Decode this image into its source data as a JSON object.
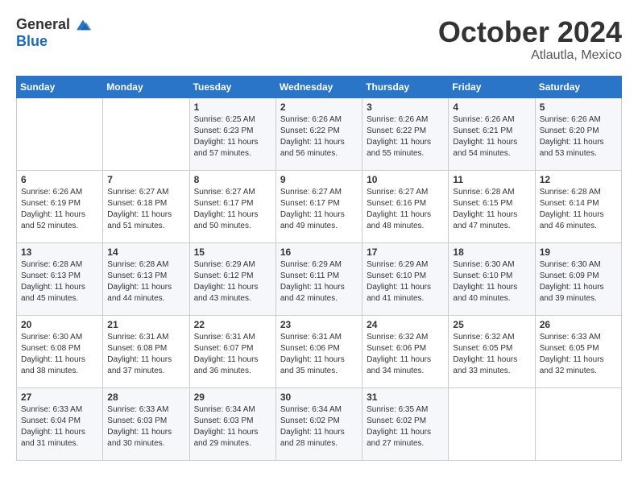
{
  "logo": {
    "general": "General",
    "blue": "Blue"
  },
  "title": "October 2024",
  "subtitle": "Atlautla, Mexico",
  "days_of_week": [
    "Sunday",
    "Monday",
    "Tuesday",
    "Wednesday",
    "Thursday",
    "Friday",
    "Saturday"
  ],
  "weeks": [
    [
      {
        "day": "",
        "info": ""
      },
      {
        "day": "",
        "info": ""
      },
      {
        "day": "1",
        "info": "Sunrise: 6:25 AM\nSunset: 6:23 PM\nDaylight: 11 hours and 57 minutes."
      },
      {
        "day": "2",
        "info": "Sunrise: 6:26 AM\nSunset: 6:22 PM\nDaylight: 11 hours and 56 minutes."
      },
      {
        "day": "3",
        "info": "Sunrise: 6:26 AM\nSunset: 6:22 PM\nDaylight: 11 hours and 55 minutes."
      },
      {
        "day": "4",
        "info": "Sunrise: 6:26 AM\nSunset: 6:21 PM\nDaylight: 11 hours and 54 minutes."
      },
      {
        "day": "5",
        "info": "Sunrise: 6:26 AM\nSunset: 6:20 PM\nDaylight: 11 hours and 53 minutes."
      }
    ],
    [
      {
        "day": "6",
        "info": "Sunrise: 6:26 AM\nSunset: 6:19 PM\nDaylight: 11 hours and 52 minutes."
      },
      {
        "day": "7",
        "info": "Sunrise: 6:27 AM\nSunset: 6:18 PM\nDaylight: 11 hours and 51 minutes."
      },
      {
        "day": "8",
        "info": "Sunrise: 6:27 AM\nSunset: 6:17 PM\nDaylight: 11 hours and 50 minutes."
      },
      {
        "day": "9",
        "info": "Sunrise: 6:27 AM\nSunset: 6:17 PM\nDaylight: 11 hours and 49 minutes."
      },
      {
        "day": "10",
        "info": "Sunrise: 6:27 AM\nSunset: 6:16 PM\nDaylight: 11 hours and 48 minutes."
      },
      {
        "day": "11",
        "info": "Sunrise: 6:28 AM\nSunset: 6:15 PM\nDaylight: 11 hours and 47 minutes."
      },
      {
        "day": "12",
        "info": "Sunrise: 6:28 AM\nSunset: 6:14 PM\nDaylight: 11 hours and 46 minutes."
      }
    ],
    [
      {
        "day": "13",
        "info": "Sunrise: 6:28 AM\nSunset: 6:13 PM\nDaylight: 11 hours and 45 minutes."
      },
      {
        "day": "14",
        "info": "Sunrise: 6:28 AM\nSunset: 6:13 PM\nDaylight: 11 hours and 44 minutes."
      },
      {
        "day": "15",
        "info": "Sunrise: 6:29 AM\nSunset: 6:12 PM\nDaylight: 11 hours and 43 minutes."
      },
      {
        "day": "16",
        "info": "Sunrise: 6:29 AM\nSunset: 6:11 PM\nDaylight: 11 hours and 42 minutes."
      },
      {
        "day": "17",
        "info": "Sunrise: 6:29 AM\nSunset: 6:10 PM\nDaylight: 11 hours and 41 minutes."
      },
      {
        "day": "18",
        "info": "Sunrise: 6:30 AM\nSunset: 6:10 PM\nDaylight: 11 hours and 40 minutes."
      },
      {
        "day": "19",
        "info": "Sunrise: 6:30 AM\nSunset: 6:09 PM\nDaylight: 11 hours and 39 minutes."
      }
    ],
    [
      {
        "day": "20",
        "info": "Sunrise: 6:30 AM\nSunset: 6:08 PM\nDaylight: 11 hours and 38 minutes."
      },
      {
        "day": "21",
        "info": "Sunrise: 6:31 AM\nSunset: 6:08 PM\nDaylight: 11 hours and 37 minutes."
      },
      {
        "day": "22",
        "info": "Sunrise: 6:31 AM\nSunset: 6:07 PM\nDaylight: 11 hours and 36 minutes."
      },
      {
        "day": "23",
        "info": "Sunrise: 6:31 AM\nSunset: 6:06 PM\nDaylight: 11 hours and 35 minutes."
      },
      {
        "day": "24",
        "info": "Sunrise: 6:32 AM\nSunset: 6:06 PM\nDaylight: 11 hours and 34 minutes."
      },
      {
        "day": "25",
        "info": "Sunrise: 6:32 AM\nSunset: 6:05 PM\nDaylight: 11 hours and 33 minutes."
      },
      {
        "day": "26",
        "info": "Sunrise: 6:33 AM\nSunset: 6:05 PM\nDaylight: 11 hours and 32 minutes."
      }
    ],
    [
      {
        "day": "27",
        "info": "Sunrise: 6:33 AM\nSunset: 6:04 PM\nDaylight: 11 hours and 31 minutes."
      },
      {
        "day": "28",
        "info": "Sunrise: 6:33 AM\nSunset: 6:03 PM\nDaylight: 11 hours and 30 minutes."
      },
      {
        "day": "29",
        "info": "Sunrise: 6:34 AM\nSunset: 6:03 PM\nDaylight: 11 hours and 29 minutes."
      },
      {
        "day": "30",
        "info": "Sunrise: 6:34 AM\nSunset: 6:02 PM\nDaylight: 11 hours and 28 minutes."
      },
      {
        "day": "31",
        "info": "Sunrise: 6:35 AM\nSunset: 6:02 PM\nDaylight: 11 hours and 27 minutes."
      },
      {
        "day": "",
        "info": ""
      },
      {
        "day": "",
        "info": ""
      }
    ]
  ]
}
